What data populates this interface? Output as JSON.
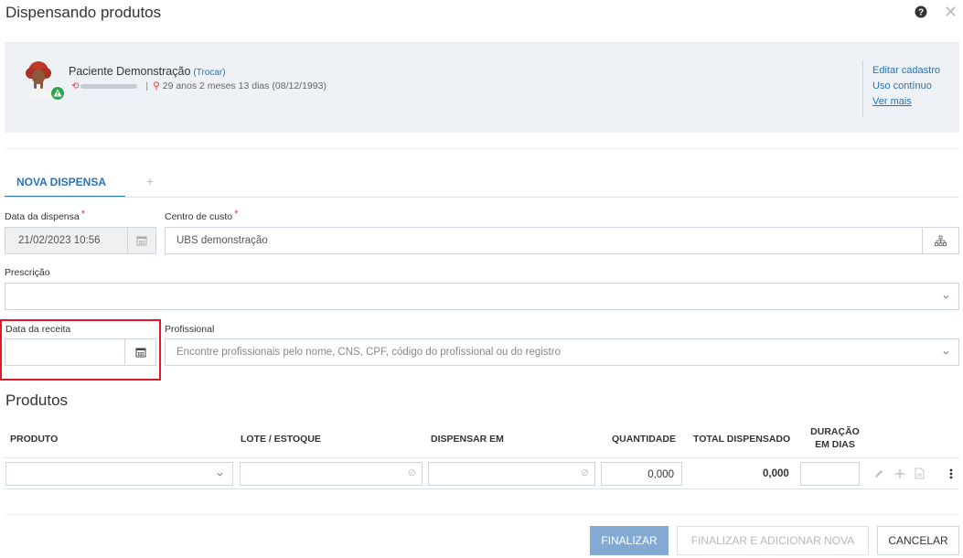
{
  "header": {
    "title": "Dispensando produtos"
  },
  "patient": {
    "name": "Paciente Demonstração",
    "swap_link": "(Trocar)",
    "age": "29 anos 2 meses 13 dias (08/12/1993)",
    "links": {
      "edit": "Editar cadastro",
      "continuous": "Uso contínuo",
      "more": "Ver mais"
    }
  },
  "tabs": {
    "active": "NOVA DISPENSA",
    "add": "+"
  },
  "form": {
    "dispense_date": {
      "label": "Data da dispensa",
      "required": "*",
      "value": "21/02/2023 10:56"
    },
    "cost_center": {
      "label": "Centro de custo",
      "required": "*",
      "value": "UBS demonstração"
    },
    "prescription": {
      "label": "Prescrição",
      "value": ""
    },
    "recipe_date": {
      "label": "Data da receita",
      "value": ""
    },
    "professional": {
      "label": "Profissional",
      "placeholder": "Encontre profissionais pelo nome, CNS, CPF, código do profissional ou do registro"
    }
  },
  "products": {
    "section_title": "Produtos",
    "columns": {
      "product": "PRODUTO",
      "lot": "LOTE / ESTOQUE",
      "dispense_in": "DISPENSAR EM",
      "quantity": "QUANTIDADE",
      "total": "TOTAL DISPENSADO",
      "duration_1": "DURAÇÃO",
      "duration_2": "EM DIAS"
    },
    "row": {
      "quantity": "0,000",
      "total": "0,000"
    }
  },
  "footer": {
    "finalize": "FINALIZAR",
    "finalize_add": "FINALIZAR E ADICIONAR NOVA",
    "cancel": "CANCELAR"
  },
  "colors": {
    "accent": "#2a73b8",
    "required": "#e23b3b",
    "highlight": "#e0182a",
    "primary_button": "#83aad3"
  }
}
